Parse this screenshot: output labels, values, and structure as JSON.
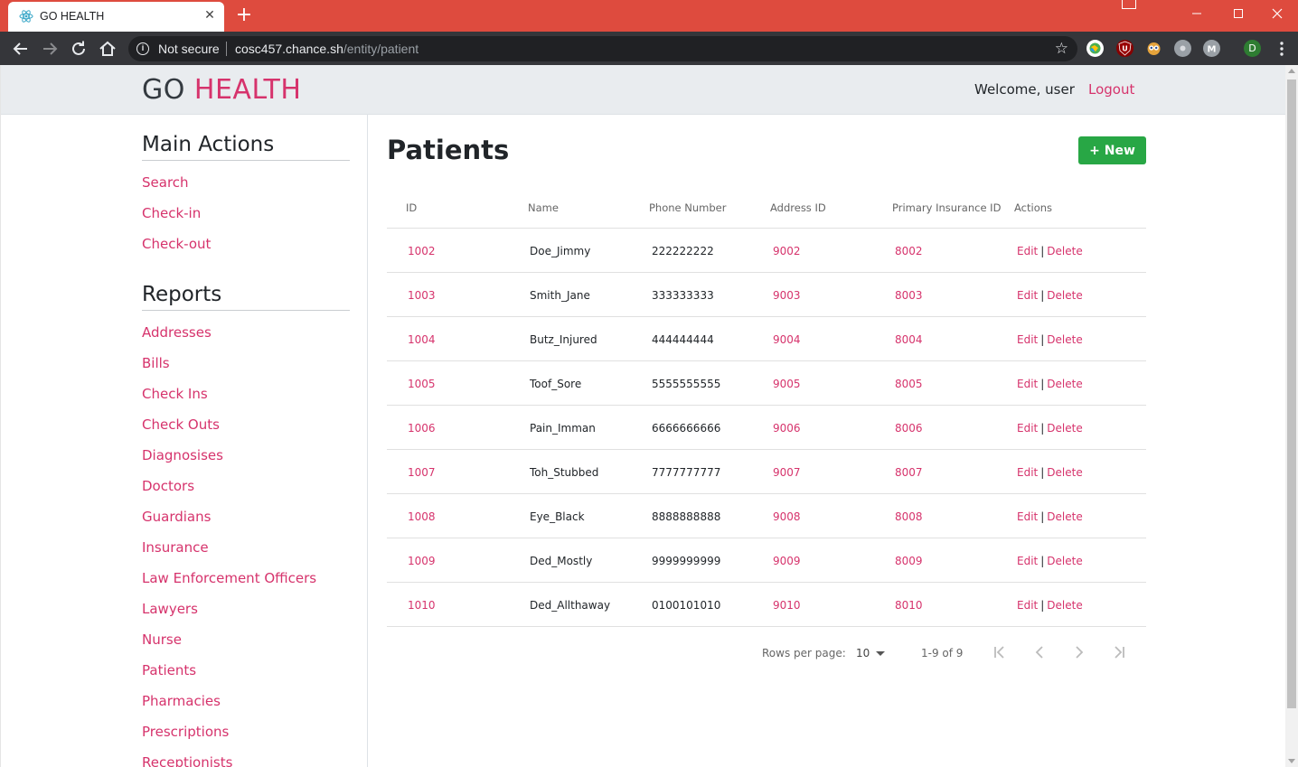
{
  "browser": {
    "tab_title": "GO HEALTH",
    "security_label": "Not secure",
    "url_host": "cosc457.chance.sh",
    "url_path": "/entity/patient",
    "profile_initial": "D"
  },
  "header": {
    "brand_go": "GO",
    "brand_health": "HEALTH",
    "welcome": "Welcome, user",
    "logout": "Logout"
  },
  "sidebar": {
    "main_actions_title": "Main Actions",
    "main_actions": [
      "Search",
      "Check-in",
      "Check-out"
    ],
    "reports_title": "Reports",
    "reports": [
      "Addresses",
      "Bills",
      "Check Ins",
      "Check Outs",
      "Diagnosises",
      "Doctors",
      "Guardians",
      "Insurance",
      "Law Enforcement Officers",
      "Lawyers",
      "Nurse",
      "Patients",
      "Pharmacies",
      "Prescriptions",
      "Receptionists"
    ]
  },
  "main": {
    "title": "Patients",
    "new_button": "+ New",
    "columns": [
      "ID",
      "Name",
      "Phone Number",
      "Address ID",
      "Primary Insurance ID",
      "Actions"
    ],
    "rows": [
      {
        "id": "1002",
        "name": "Doe_Jimmy",
        "phone": "222222222",
        "address_id": "9002",
        "insurance_id": "8002"
      },
      {
        "id": "1003",
        "name": "Smith_Jane",
        "phone": "333333333",
        "address_id": "9003",
        "insurance_id": "8003"
      },
      {
        "id": "1004",
        "name": "Butz_Injured",
        "phone": "444444444",
        "address_id": "9004",
        "insurance_id": "8004"
      },
      {
        "id": "1005",
        "name": "Toof_Sore",
        "phone": "5555555555",
        "address_id": "9005",
        "insurance_id": "8005"
      },
      {
        "id": "1006",
        "name": "Pain_Imman",
        "phone": "6666666666",
        "address_id": "9006",
        "insurance_id": "8006"
      },
      {
        "id": "1007",
        "name": "Toh_Stubbed",
        "phone": "7777777777",
        "address_id": "9007",
        "insurance_id": "8007"
      },
      {
        "id": "1008",
        "name": "Eye_Black",
        "phone": "8888888888",
        "address_id": "9008",
        "insurance_id": "8008"
      },
      {
        "id": "1009",
        "name": "Ded_Mostly",
        "phone": "9999999999",
        "address_id": "9009",
        "insurance_id": "8009"
      },
      {
        "id": "1010",
        "name": "Ded_Allthaway",
        "phone": "0100101010",
        "address_id": "9010",
        "insurance_id": "8010"
      }
    ],
    "edit_label": "Edit",
    "delete_label": "Delete",
    "separator": "|",
    "pagination": {
      "rows_per_page_label": "Rows per page:",
      "rows_per_page_value": "10",
      "range": "1-9 of 9"
    }
  },
  "colors": {
    "accent": "#d6336c",
    "success": "#28a745",
    "chrome_tab_strip": "#de4b3e",
    "chrome_toolbar": "#35363a"
  }
}
